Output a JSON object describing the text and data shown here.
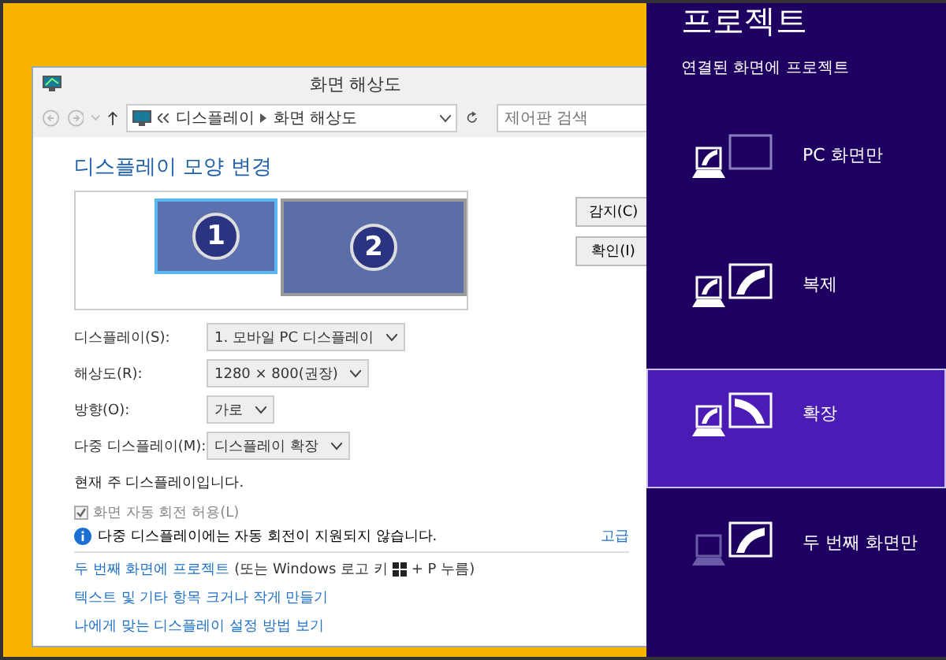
{
  "window": {
    "title": "화면 해상도"
  },
  "address_bar": {
    "path": [
      "디스플레이",
      "화면 해상도"
    ]
  },
  "search": {
    "placeholder": "제어판 검색"
  },
  "heading": "디스플레이 모양 변경",
  "monitors": [
    {
      "label": "1",
      "selected": true
    },
    {
      "label": "2",
      "selected": false
    }
  ],
  "monitor_buttons": [
    "감지(C)",
    "확인(I)"
  ],
  "settings": [
    {
      "label": "디스플레이(S):",
      "value": "1. 모바일 PC 디스플레이"
    },
    {
      "label": "해상도(R):",
      "value": "1280 × 800(권장)"
    },
    {
      "label": "방향(O):",
      "value": "가로"
    },
    {
      "label": "다중 디스플레이(M):",
      "value": "디스플레이 확장"
    }
  ],
  "status_text": "현재 주 디스플레이입니다.",
  "auto_rotate": {
    "label": "화면 자동 회전 허용(L)",
    "checked": true,
    "disabled": true
  },
  "info": "다중 디스플레이에는 자동 회전이 지원되지 않습니다.",
  "advanced_link": "고급",
  "project_link": {
    "link": "두 번째 화면에 프로젝트",
    "before_key": "(또는 Windows 로고 키",
    "after_key": "+ P 누름)"
  },
  "links": [
    "텍스트 및 기타 항목 크거나 작게 만들기",
    "나에게 맞는 디스플레이 설정 방법 보기"
  ],
  "project_panel": {
    "title": "프로젝트",
    "subtitle": "연결된 화면에 프로젝트",
    "options": [
      {
        "kind": "pc_only",
        "label": "PC 화면만",
        "selected": false
      },
      {
        "kind": "duplicate",
        "label": "복제",
        "selected": false
      },
      {
        "kind": "extend",
        "label": "확장",
        "selected": true
      },
      {
        "kind": "second_only",
        "label": "두 번째 화면만",
        "selected": false
      }
    ]
  }
}
